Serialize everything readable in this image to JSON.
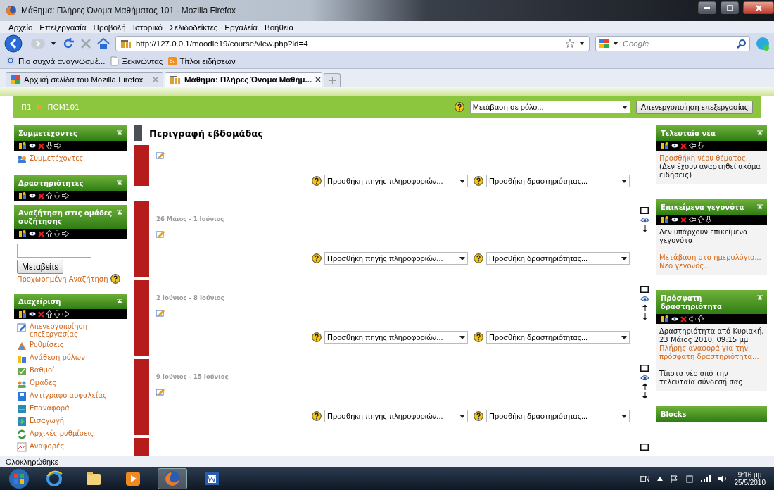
{
  "window": {
    "title": "Μάθημα: Πλήρες Όνομα Μαθήματος 101 - Mozilla Firefox"
  },
  "menu": [
    "Αρχείο",
    "Επεξεργασία",
    "Προβολή",
    "Ιστορικό",
    "Σελιδοδείκτες",
    "Εργαλεία",
    "Βοήθεια"
  ],
  "address": {
    "url": "http://127.0.0.1/moodle19/course/view.php?id=4"
  },
  "search": {
    "placeholder": "Google"
  },
  "bookmarks": [
    {
      "label": "Πιο συχνά αναγνωσμέ...",
      "kind": "search"
    },
    {
      "label": "Ξεκινώντας",
      "kind": "page"
    },
    {
      "label": "Τίτλοι ειδήσεων",
      "kind": "feed"
    }
  ],
  "tabs": [
    {
      "label": "Αρχική σελίδα του Mozilla Firefox",
      "selected": false,
      "kind": "google"
    },
    {
      "label": "Μάθημα: Πλήρες Όνομα Μαθήμ...",
      "selected": true,
      "kind": "moodle"
    }
  ],
  "breadcrumb": [
    {
      "label": "Π1",
      "link": true
    },
    {
      "label": "ΠΟΜ101",
      "link": false
    }
  ],
  "role_select": {
    "value": "Μετάβαση σε ρόλο..."
  },
  "edit_button": "Απενεργοποίηση επεξεργασίας",
  "left_blocks": [
    {
      "title": "Συμμετέχοντες",
      "kind": "links",
      "controls": [
        {
          "kind": "roles"
        },
        {
          "kind": "hide"
        },
        {
          "kind": "delete"
        },
        {
          "kind": "down"
        },
        {
          "kind": "right"
        }
      ],
      "items": [
        "Συμμετέχοντες"
      ]
    },
    {
      "title": "Δραστηριότητες",
      "kind": "empty",
      "controls": [
        {
          "kind": "roles"
        },
        {
          "kind": "hide"
        },
        {
          "kind": "delete"
        },
        {
          "kind": "up"
        },
        {
          "kind": "down"
        },
        {
          "kind": "right"
        }
      ]
    },
    {
      "title": "Αναζήτηση στις ομάδες συζήτησης",
      "kind": "search",
      "controls": [
        {
          "kind": "roles"
        },
        {
          "kind": "hide"
        },
        {
          "kind": "delete"
        },
        {
          "kind": "up"
        },
        {
          "kind": "down"
        },
        {
          "kind": "right"
        }
      ],
      "button": "Μεταβείτε",
      "link": "Προχωρημένη Αναζήτηση"
    },
    {
      "title": "Διαχείριση",
      "kind": "links",
      "controls": [
        {
          "kind": "roles"
        },
        {
          "kind": "hide"
        },
        {
          "kind": "delete"
        },
        {
          "kind": "up"
        },
        {
          "kind": "down"
        },
        {
          "kind": "right"
        }
      ],
      "items": [
        "Απενεργοποίηση επεξεργασίας",
        "Ρυθμίσεις",
        "Ανάθεση ρόλων",
        "Βαθμοί",
        "Ομάδες",
        "Αντίγραφο ασφαλείας",
        "Επαναφορά",
        "Εισαγωγή",
        "Αρχικές ρυθμίσεις",
        "Αναφορές"
      ]
    }
  ],
  "course": {
    "title": "Περιγραφή εβδομάδας",
    "sections": [
      {
        "kind": "intro",
        "resource_select": "Προσθήκη πηγής πληροφοριών...",
        "activity_select": "Προσθήκη δραστηριότητας..."
      },
      {
        "kind": "week",
        "dates": "26 Μάιος - 1 Ιούνιος",
        "resource_select": "Προσθήκη πηγής πληροφοριών...",
        "activity_select": "Προσθήκη δραστηριότητας...",
        "controls": [
          {
            "kind": "highlight"
          },
          {
            "kind": "hide"
          },
          {
            "kind": "down"
          }
        ]
      },
      {
        "kind": "week",
        "dates": "2 Ιούνιος - 8 Ιούνιος",
        "resource_select": "Προσθήκη πηγής πληροφοριών...",
        "activity_select": "Προσθήκη δραστηριότητας...",
        "controls": [
          {
            "kind": "highlight"
          },
          {
            "kind": "hide"
          },
          {
            "kind": "up"
          },
          {
            "kind": "down"
          }
        ]
      },
      {
        "kind": "week",
        "dates": "9 Ιούνιος - 15 Ιούνιος",
        "resource_select": "Προσθήκη πηγής πληροφοριών...",
        "activity_select": "Προσθήκη δραστηριότητας...",
        "controls": [
          {
            "kind": "highlight"
          },
          {
            "kind": "hide"
          },
          {
            "kind": "up"
          },
          {
            "kind": "down"
          }
        ]
      },
      {
        "kind": "cut",
        "controls": [
          {
            "kind": "highlight"
          }
        ]
      }
    ]
  },
  "right_blocks": [
    {
      "title": "Τελευταία νέα",
      "controls": [
        {
          "kind": "roles"
        },
        {
          "kind": "hide"
        },
        {
          "kind": "delete"
        },
        {
          "kind": "left"
        },
        {
          "kind": "down"
        }
      ],
      "paragraphs": [
        [
          {
            "text": "Προσθήκη νέου θέματος...",
            "link": true
          },
          {
            "text": "(Δεν έχουν αναρτηθεί ακόμα ειδήσεις)",
            "link": false
          }
        ]
      ]
    },
    {
      "title": "Επικείμενα γεγονότα",
      "controls": [
        {
          "kind": "roles"
        },
        {
          "kind": "hide"
        },
        {
          "kind": "delete"
        },
        {
          "kind": "left"
        },
        {
          "kind": "up"
        },
        {
          "kind": "down"
        }
      ],
      "paragraphs": [
        [
          {
            "text": "Δεν υπάρχουν επικείμενα γεγονότα",
            "link": false
          }
        ],
        [
          {
            "text": "Μετάβαση στο ημερολόγιο...",
            "link": true
          },
          {
            "text": "Νέο γεγονός...",
            "link": true
          }
        ]
      ]
    },
    {
      "title": "Πρόσφατη δραστηριότητα",
      "controls": [
        {
          "kind": "roles"
        },
        {
          "kind": "hide"
        },
        {
          "kind": "delete"
        },
        {
          "kind": "left"
        },
        {
          "kind": "up"
        }
      ],
      "paragraphs": [
        [
          {
            "text": "Δραστηριότητα από Κυριακή, 23 Μάιος 2010, 09:15 μμ",
            "link": false
          },
          {
            "text": "Πλήρης αναφορά για την πρόσφατη δραστηριότητα...",
            "link": true
          }
        ],
        [
          {
            "text": "Τίποτα νέο από την τελευταία σύνδεσή σας",
            "link": false
          }
        ]
      ]
    },
    {
      "title": "Blocks"
    }
  ],
  "status_bar": "Ολοκληρώθηκε",
  "taskbar": {
    "apps": [
      {
        "kind": "ie",
        "selected": false
      },
      {
        "kind": "folder",
        "selected": false
      },
      {
        "kind": "media",
        "selected": false
      },
      {
        "kind": "firefox",
        "selected": true
      },
      {
        "kind": "word",
        "selected": false
      }
    ],
    "language": "EN",
    "time": "9:16 μμ",
    "date": "25/5/2010"
  }
}
